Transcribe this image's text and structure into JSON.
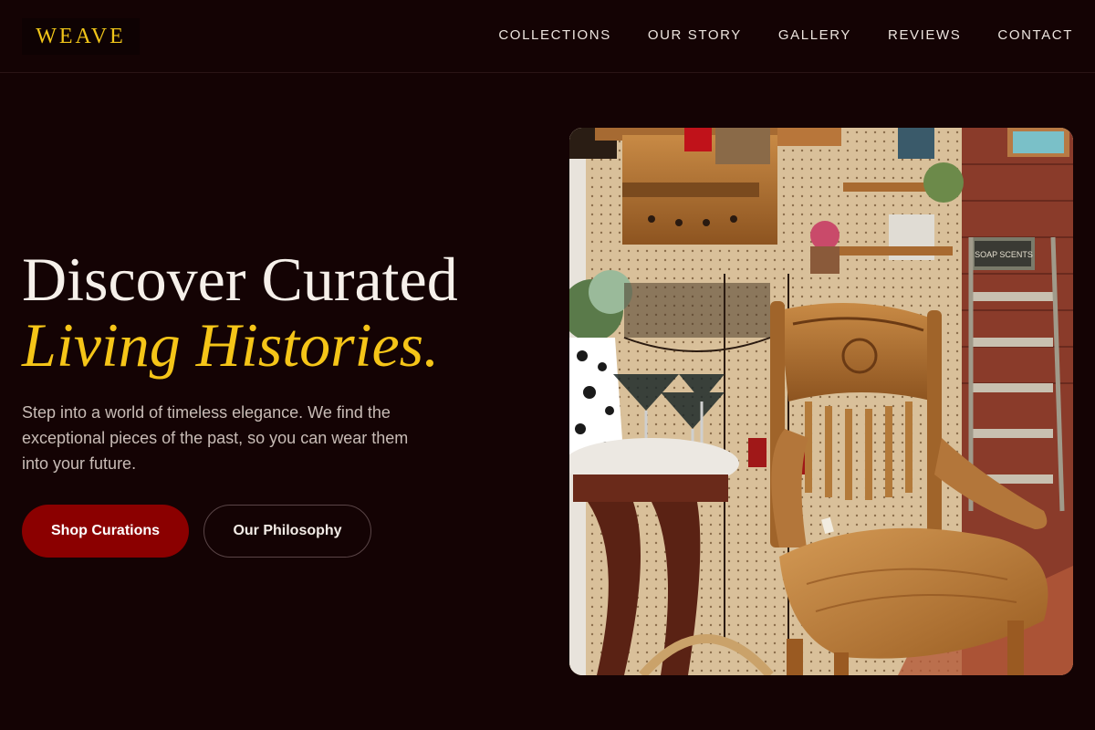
{
  "brand": {
    "logo_text": "WEAVE"
  },
  "nav": {
    "items": [
      "COLLECTIONS",
      "OUR STORY",
      "GALLERY",
      "REVIEWS",
      "CONTACT"
    ]
  },
  "hero": {
    "title_line1": "Discover Curated",
    "title_line2": "Living Histories.",
    "subtitle": "Step into a world of timeless elegance. We find the exceptional pieces of the past, so you can wear them into your future.",
    "primary_button": "Shop Curations",
    "secondary_button": "Our Philosophy"
  },
  "image": {
    "sign_text": "SOAP SCENTS"
  },
  "colors": {
    "background": "#140304",
    "accent_gold": "#f5c518",
    "primary_red": "#8b0000"
  }
}
